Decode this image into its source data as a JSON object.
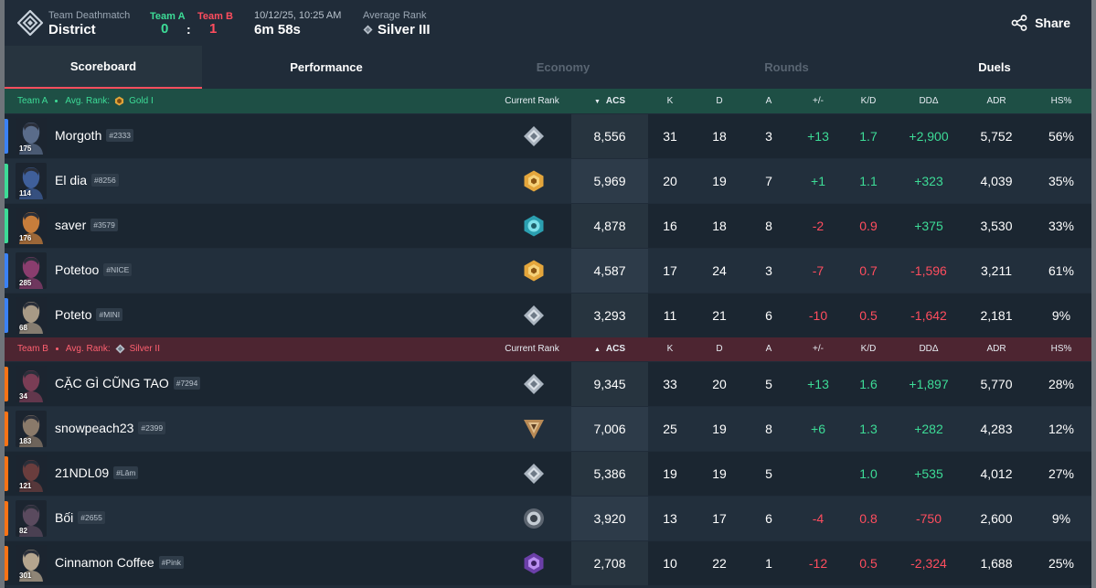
{
  "header": {
    "mode": "Team Deathmatch",
    "map": "District",
    "team_a_label": "Team A",
    "team_b_label": "Team B",
    "score_a": "0",
    "score_sep": ":",
    "score_b": "1",
    "datetime": "10/12/25, 10:25 AM",
    "duration": "6m 58s",
    "avg_rank_label": "Average Rank",
    "avg_rank": "Silver III",
    "share": "Share"
  },
  "tabs": [
    {
      "label": "Scoreboard",
      "state": "active"
    },
    {
      "label": "Performance",
      "state": "normal"
    },
    {
      "label": "Economy",
      "state": "disabled"
    },
    {
      "label": "Rounds",
      "state": "disabled"
    },
    {
      "label": "Duels",
      "state": "normal"
    }
  ],
  "columns": {
    "current_rank": "Current Rank",
    "acs": "ACS",
    "k": "K",
    "d": "D",
    "a": "A",
    "pm": "+/-",
    "kd": "K/D",
    "dd": "DDΔ",
    "adr": "ADR",
    "hs": "HS%"
  },
  "team_a": {
    "title": "Team A",
    "avg_label": "Avg. Rank:",
    "avg_rank": "Gold I",
    "color": "#3ddc97",
    "players": [
      {
        "name": "Morgoth",
        "tag": "#2333",
        "level": "175",
        "bar": "#3b82f6",
        "rank_icon": "silver-rank-icon",
        "acs": "8,556",
        "k": "31",
        "d": "18",
        "a": "3",
        "pm": "+13",
        "kd": "1.7",
        "dd": "+2,900",
        "adr": "5,752",
        "hs": "56%"
      },
      {
        "name": "El dia",
        "tag": "#8256",
        "level": "114",
        "bar": "#3ddc97",
        "rank_icon": "gold-rank-icon",
        "acs": "5,969",
        "k": "20",
        "d": "19",
        "a": "7",
        "pm": "+1",
        "kd": "1.1",
        "dd": "+323",
        "adr": "4,039",
        "hs": "35%"
      },
      {
        "name": "saver",
        "tag": "#3579",
        "level": "176",
        "bar": "#3ddc97",
        "rank_icon": "platinum-rank-icon",
        "acs": "4,878",
        "k": "16",
        "d": "18",
        "a": "8",
        "pm": "-2",
        "kd": "0.9",
        "dd": "+375",
        "adr": "3,530",
        "hs": "33%"
      },
      {
        "name": "Potetoo",
        "tag": "#NICE",
        "level": "285",
        "bar": "#3b82f6",
        "rank_icon": "gold-rank-icon",
        "acs": "4,587",
        "k": "17",
        "d": "24",
        "a": "3",
        "pm": "-7",
        "kd": "0.7",
        "dd": "-1,596",
        "adr": "3,211",
        "hs": "61%"
      },
      {
        "name": "Poteto",
        "tag": "#MINI",
        "level": "68",
        "bar": "#3b82f6",
        "rank_icon": "silver-rank-icon",
        "acs": "3,293",
        "k": "11",
        "d": "21",
        "a": "6",
        "pm": "-10",
        "kd": "0.5",
        "dd": "-1,642",
        "adr": "2,181",
        "hs": "9%"
      }
    ]
  },
  "team_b": {
    "title": "Team B",
    "avg_label": "Avg. Rank:",
    "avg_rank": "Silver II",
    "color": "#ff4d5e",
    "players": [
      {
        "name": "CẶC GÌ CŨNG TAO",
        "tag": "#7294",
        "level": "34",
        "bar": "#f97316",
        "rank_icon": "silver-rank-icon",
        "acs": "9,345",
        "k": "33",
        "d": "20",
        "a": "5",
        "pm": "+13",
        "kd": "1.6",
        "dd": "+1,897",
        "adr": "5,770",
        "hs": "28%"
      },
      {
        "name": "snowpeach23",
        "tag": "#2399",
        "level": "183",
        "bar": "#f97316",
        "rank_icon": "bronze-rank-icon",
        "acs": "7,006",
        "k": "25",
        "d": "19",
        "a": "8",
        "pm": "+6",
        "kd": "1.3",
        "dd": "+282",
        "adr": "4,283",
        "hs": "12%"
      },
      {
        "name": "21NDL09",
        "tag": "#Lâm",
        "level": "121",
        "bar": "#f97316",
        "rank_icon": "silver-rank-icon",
        "acs": "5,386",
        "k": "19",
        "d": "19",
        "a": "5",
        "pm": "",
        "kd": "1.0",
        "dd": "+535",
        "adr": "4,012",
        "hs": "27%"
      },
      {
        "name": "Bối",
        "tag": "#2655",
        "level": "82",
        "bar": "#f97316",
        "rank_icon": "iron-rank-icon",
        "acs": "3,920",
        "k": "13",
        "d": "17",
        "a": "6",
        "pm": "-4",
        "kd": "0.8",
        "dd": "-750",
        "adr": "2,600",
        "hs": "9%"
      },
      {
        "name": "Cinnamon Coffee",
        "tag": "#Pink",
        "level": "301",
        "bar": "#f97316",
        "rank_icon": "ascendant-rank-icon",
        "acs": "2,708",
        "k": "10",
        "d": "22",
        "a": "1",
        "pm": "-12",
        "kd": "0.5",
        "dd": "-2,324",
        "adr": "1,688",
        "hs": "25%"
      }
    ]
  }
}
